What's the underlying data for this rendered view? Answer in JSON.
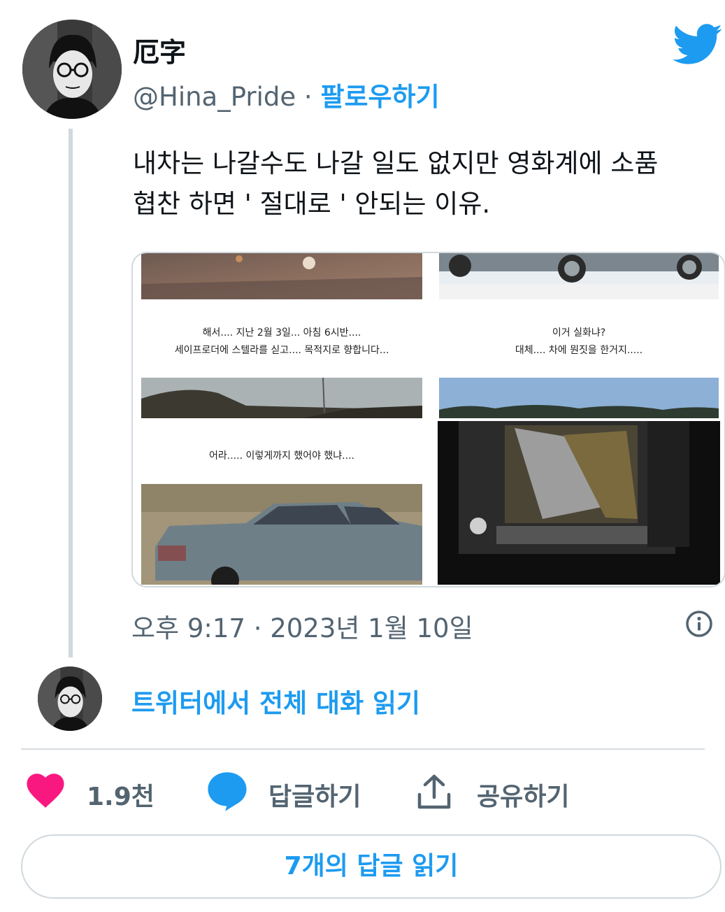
{
  "author": {
    "display_name": "厄字",
    "handle": "@Hina_Pride",
    "separator": "·",
    "follow_label": "팔로우하기"
  },
  "tweet": {
    "text_line1": "내차는 나갈수도 나갈 일도 없지만 영화계에 소품",
    "text_line2": "협찬 하면 ' 절대로 ' 안되는 이유."
  },
  "media": {
    "captions": {
      "p1_line1": "해서.... 지난 2월 3일... 아침 6시반....",
      "p1_line2": "세이프로더에 스텔라를 싣고.... 목적지로 향합니다...",
      "p2_line1": "이거 실화냐?",
      "p2_line2": "대체.... 차에 뭔짓을 한거지.....",
      "p3_line1": "어라..... 이렇게까지 했어야 했냐...."
    }
  },
  "meta": {
    "timestamp": "오후 9:17 · 2023년 1월 10일",
    "read_conversation": "트위터에서 전체 대화 읽기"
  },
  "actions": {
    "like_count": "1.9천",
    "reply_label": "답글하기",
    "share_label": "공유하기",
    "read_replies": "7개의 답글 읽기"
  },
  "icons": {
    "brand": "twitter-bird-icon",
    "like": "heart-icon",
    "reply": "speech-bubble-icon",
    "share": "share-upload-icon",
    "info": "info-icon"
  },
  "colors": {
    "accent": "#1d9bf0",
    "like": "#f91880",
    "muted": "#536471"
  }
}
